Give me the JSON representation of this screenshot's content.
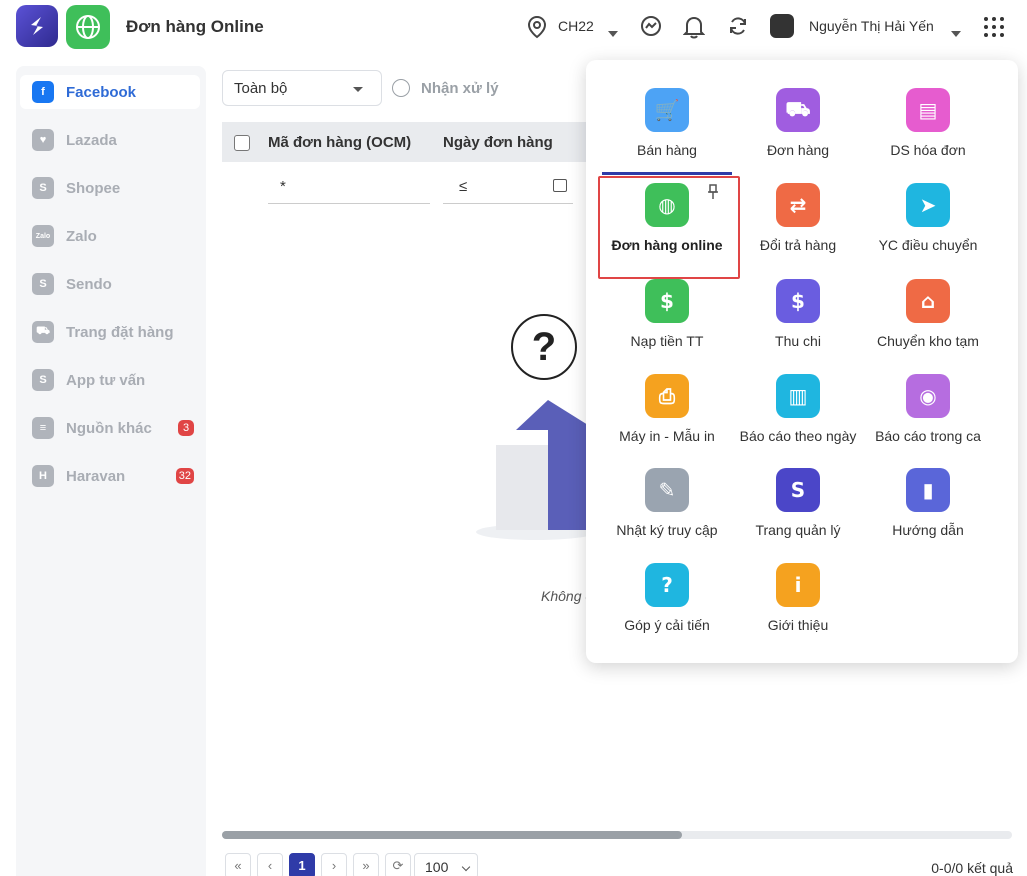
{
  "header": {
    "title": "Đơn hàng Online",
    "store": "CH22",
    "user_name": "Nguyễn Thị Hải Yến"
  },
  "sidebar": {
    "items": [
      {
        "label": "Facebook",
        "icon": "facebook-icon",
        "active": true
      },
      {
        "label": "Lazada",
        "icon": "lazada-icon"
      },
      {
        "label": "Shopee",
        "icon": "shopee-icon"
      },
      {
        "label": "Zalo",
        "icon": "zalo-icon"
      },
      {
        "label": "Sendo",
        "icon": "sendo-icon"
      },
      {
        "label": "Trang đặt hàng",
        "icon": "cart-icon"
      },
      {
        "label": "App tư vấn",
        "icon": "app-icon"
      },
      {
        "label": "Nguồn khác",
        "icon": "doc-icon",
        "badge": "3"
      },
      {
        "label": "Haravan",
        "icon": "haravan-icon",
        "badge": "32"
      }
    ]
  },
  "filters": {
    "status_value": "Toàn bộ",
    "process_label": "Nhận xử lý",
    "star_value": "*",
    "date_operator": "≤"
  },
  "table": {
    "col1": "Mã đơn hàng (OCM)",
    "col2": "Ngày đơn hàng"
  },
  "empty": {
    "symbol": "?",
    "text": "Không c"
  },
  "pagination": {
    "first": "«",
    "prev": "‹",
    "current": "1",
    "next": "›",
    "last": "»",
    "page_size": "100",
    "total": "0-0/0 kết quả"
  },
  "apps": [
    {
      "label": "Bán hàng",
      "icon": "cart-icon",
      "color": "#4da3f5"
    },
    {
      "label": "Đơn hàng",
      "icon": "truck-icon",
      "color": "#a05de0"
    },
    {
      "label": "DS hóa đơn",
      "icon": "invoice-icon",
      "color": "#e65ccf"
    },
    {
      "label": "Đơn hàng online",
      "icon": "globe-icon",
      "color": "#3fbf5a"
    },
    {
      "label": "Đổi trả hàng",
      "icon": "return-icon",
      "color": "#ef6a45"
    },
    {
      "label": "YC điều chuyển",
      "icon": "transfer-icon",
      "color": "#1fb6e0"
    },
    {
      "label": "Nạp tiền TT",
      "icon": "topup-icon",
      "color": "#3fbf5a"
    },
    {
      "label": "Thu chi",
      "icon": "dollar-icon",
      "color": "#6a5de0"
    },
    {
      "label": "Chuyển kho tạm",
      "icon": "warehouse-icon",
      "color": "#ef6a45"
    },
    {
      "label": "Máy in - Mẫu in",
      "icon": "printer-icon",
      "color": "#f5a21f"
    },
    {
      "label": "Báo cáo theo ngày",
      "icon": "report-icon",
      "color": "#1fb6e0"
    },
    {
      "label": "Báo cáo trong ca",
      "icon": "shift-report-icon",
      "color": "#b66de0"
    },
    {
      "label": "Nhật ký truy cập",
      "icon": "log-icon",
      "color": "#9aa4b0"
    },
    {
      "label": "Trang quản lý",
      "icon": "admin-icon",
      "color": "#4b46c8"
    },
    {
      "label": "Hướng dẫn",
      "icon": "book-icon",
      "color": "#5a66d9"
    },
    {
      "label": "Góp ý cải tiến",
      "icon": "feedback-icon",
      "color": "#1fb6e0"
    },
    {
      "label": "Giới thiệu",
      "icon": "info-icon",
      "color": "#f5a21f"
    }
  ]
}
